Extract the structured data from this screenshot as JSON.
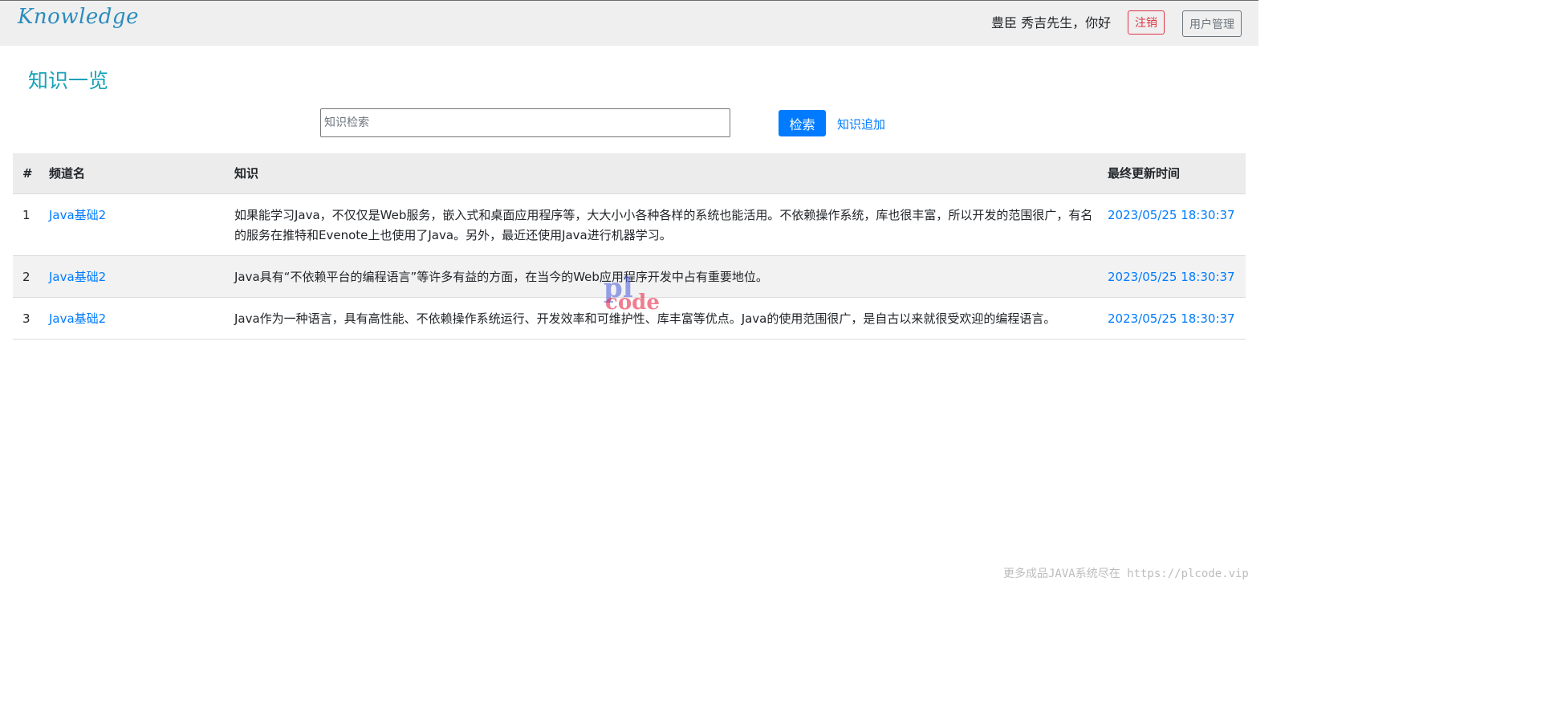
{
  "header": {
    "logo_text": "Knowledge",
    "greeting": "豊臣 秀吉先生，你好",
    "logout_label": "注销",
    "user_admin_label": "用户管理"
  },
  "page": {
    "title": "知识一览"
  },
  "search": {
    "placeholder": "知识检索",
    "value": "",
    "button_label": "检索",
    "add_link_label": "知识追加"
  },
  "table": {
    "columns": [
      "#",
      "频道名",
      "知识",
      "最终更新时间"
    ],
    "rows": [
      {
        "num": "1",
        "channel": "Java基础2",
        "knowledge": "如果能学习Java，不仅仅是Web服务，嵌入式和桌面应用程序等，大大小小各种各样的系统也能活用。不依赖操作系统，库也很丰富，所以开发的范围很广，有名的服务在推特和Evenote上也使用了Java。另外，最近还使用Java进行机器学习。",
        "updated": "2023/05/25 18:30:37"
      },
      {
        "num": "2",
        "channel": "Java基础2",
        "knowledge": "Java具有“不依赖平台的编程语言”等许多有益的方面，在当今的Web应用程序开发中占有重要地位。",
        "updated": "2023/05/25 18:30:37"
      },
      {
        "num": "3",
        "channel": "Java基础2",
        "knowledge": "Java作为一种语言，具有高性能、不依赖操作系统运行、开发效率和可维护性、库丰富等优点。Java的使用范围很广，是自古以来就很受欢迎的编程语言。",
        "updated": "2023/05/25 18:30:37"
      }
    ]
  },
  "watermark": {
    "line1": "pl",
    "line2": "code"
  },
  "footer": {
    "note": "更多成品JAVA系统尽在 https://plcode.vip"
  }
}
